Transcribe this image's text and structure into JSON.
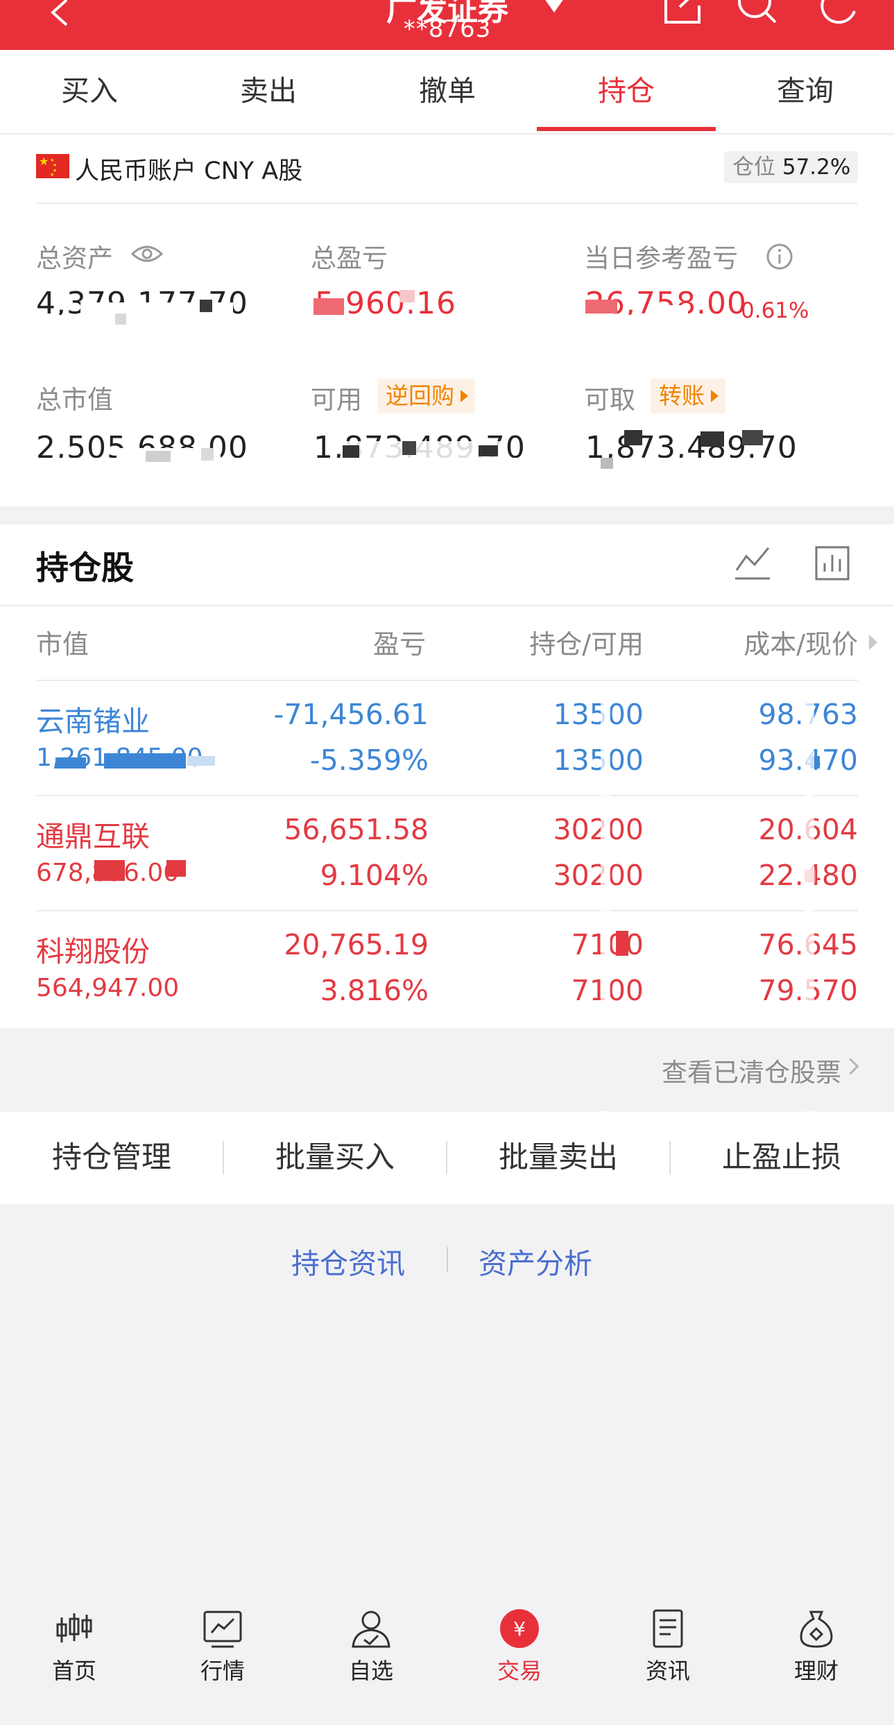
{
  "header": {
    "title": "广发证券",
    "account": "**8763",
    "brand_color": "#e8303b"
  },
  "tabs": [
    {
      "label": "买入"
    },
    {
      "label": "卖出"
    },
    {
      "label": "撤单"
    },
    {
      "label": "持仓",
      "active": true
    },
    {
      "label": "查询"
    }
  ],
  "account": {
    "name": "人民币账户 CNY A股",
    "position_label": "仓位",
    "position_value": "57.2%",
    "total_assets": {
      "label": "总资产",
      "value": "4,379,177.70"
    },
    "total_pl": {
      "label": "总盈亏",
      "value": "5,960.16"
    },
    "day_pl": {
      "label": "当日参考盈亏",
      "value": "26,758.00",
      "pct": "0.61%"
    },
    "market_value": {
      "label": "总市值",
      "value": "2,505,688.00"
    },
    "available": {
      "label": "可用",
      "value": "1,873,489.70",
      "chip": "逆回购"
    },
    "withdrawable": {
      "label": "可取",
      "value": "1,873,489.70",
      "chip": "转账"
    }
  },
  "holdings": {
    "title": "持仓股",
    "columns": [
      "市值",
      "盈亏",
      "持仓/可用",
      "成本/现价"
    ],
    "rows": [
      {
        "name": "云南锗业",
        "market_value": "1,261,845.00",
        "pl": "-71,456.61",
        "pl_pct": "-5.359%",
        "hold": "13500",
        "avail": "13500",
        "cost": "98.763",
        "price": "93.470",
        "color": "blue"
      },
      {
        "name": "通鼎互联",
        "market_value": "678,896.00",
        "pl": "56,651.58",
        "pl_pct": "9.104%",
        "hold": "30200",
        "avail": "30200",
        "cost": "20.604",
        "price": "22.480",
        "color": "red"
      },
      {
        "name": "科翔股份",
        "market_value": "564,947.00",
        "pl": "20,765.19",
        "pl_pct": "3.816%",
        "hold": "7100",
        "avail": "7100",
        "cost": "76.645",
        "price": "79.570",
        "color": "red"
      }
    ],
    "cleared_link": "查看已清仓股票"
  },
  "actions": [
    "持仓管理",
    "批量买入",
    "批量卖出",
    "止盈止损"
  ],
  "links": [
    "持仓资讯",
    "资产分析"
  ],
  "nav": [
    {
      "label": "首页",
      "icon": "candlestick-icon"
    },
    {
      "label": "行情",
      "icon": "chart-line-icon"
    },
    {
      "label": "自选",
      "icon": "user-check-icon"
    },
    {
      "label": "交易",
      "icon": "yuan-icon",
      "active": true
    },
    {
      "label": "资讯",
      "icon": "document-icon"
    },
    {
      "label": "理财",
      "icon": "money-bag-icon"
    }
  ]
}
